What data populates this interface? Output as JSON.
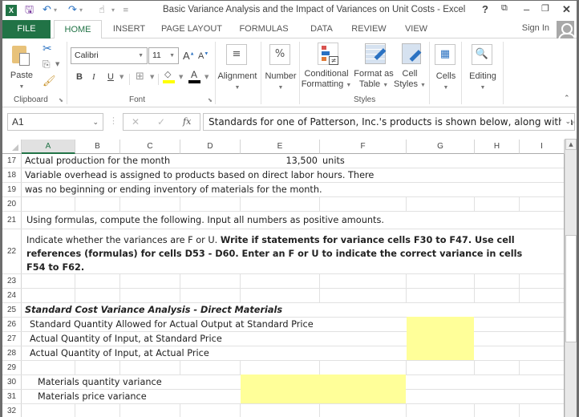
{
  "titlebar": {
    "title": "Basic Variance Analysis and the Impact of Variances on Unit Costs - Excel",
    "app_icon": "excel-icon",
    "quick_access": [
      "save-icon",
      "undo-icon",
      "redo-icon",
      "touch-mode-icon",
      "customize-qat-icon"
    ],
    "controls": {
      "help": "?",
      "ribbon_display": "⧉",
      "minimize": "–",
      "restore": "🗗",
      "close": "✕"
    }
  },
  "tabs": {
    "items": [
      "FILE",
      "HOME",
      "INSERT",
      "PAGE LAYOUT",
      "FORMULAS",
      "DATA",
      "REVIEW",
      "VIEW"
    ],
    "active": "HOME",
    "sign_in": "Sign In"
  },
  "ribbon": {
    "clipboard": {
      "label": "Clipboard",
      "paste": "Paste"
    },
    "font": {
      "label": "Font",
      "font_name": "Calibri",
      "font_size": "11",
      "bold": "B",
      "italic": "I",
      "underline": "U",
      "grow": "A",
      "shrink": "A",
      "fill_color": "#ffff00",
      "font_color": "#000000"
    },
    "alignment": {
      "label": "Alignment"
    },
    "number": {
      "label": "Number",
      "icon_text": "%"
    },
    "styles": {
      "label": "Styles",
      "conditional_formatting": [
        "Conditional",
        "Formatting"
      ],
      "format_as_table": [
        "Format as",
        "Table"
      ],
      "cell_styles": [
        "Cell",
        "Styles"
      ]
    },
    "cells": {
      "label": "Cells"
    },
    "editing": {
      "label": "Editing"
    }
  },
  "formula_bar": {
    "name_box": "A1",
    "fx": "fx",
    "cancel": "✕",
    "enter": "✓",
    "formula": "Standards for one of Patterson, Inc.'s products is shown below, along with actual"
  },
  "sheet": {
    "columns": [
      "A",
      "B",
      "C",
      "D",
      "E",
      "F",
      "G",
      "H",
      "I"
    ],
    "selected_column": "A",
    "rows": [
      {
        "num": "17",
        "cells": [
          {
            "text": "Actual production for the month"
          },
          {
            "text": "13,500",
            "align": "right"
          },
          {
            "text": "units"
          }
        ]
      },
      {
        "num": "18",
        "cells": [
          {
            "text": "Variable overhead is assigned to products based on direct labor hours. There"
          }
        ]
      },
      {
        "num": "19",
        "cells": [
          {
            "text": "was no beginning or ending inventory of materials for the month."
          }
        ]
      },
      {
        "num": "20",
        "cells": []
      },
      {
        "num": "21",
        "cells": [
          {
            "text": "Using formulas, compute the following.  Input all numbers as positive amounts."
          }
        ]
      },
      {
        "num": "22",
        "cells": [
          {
            "text_normal": "Indicate whether the variances are F or U. ",
            "text_bold_1": "Write if statements for variance cells F30 to F47. Use cell",
            "line2": "references (formulas) for cells D53 - D60. Enter an  F or U to indicate the correct variance in cells",
            "line3": "F54 to F62."
          }
        ]
      },
      {
        "num": "23",
        "cells": []
      },
      {
        "num": "24",
        "cells": []
      },
      {
        "num": "25",
        "cells": [
          {
            "text": "Standard Cost Variance Analysis - Direct Materials"
          }
        ]
      },
      {
        "num": "26",
        "cells": [
          {
            "text": "Standard Quantity Allowed for Actual Output at Standard Price"
          }
        ]
      },
      {
        "num": "27",
        "cells": [
          {
            "text": "Actual Quantity of Input, at Standard Price"
          }
        ]
      },
      {
        "num": "28",
        "cells": [
          {
            "text": "Actual Quantity of Input, at Actual Price"
          }
        ]
      },
      {
        "num": "29",
        "cells": []
      },
      {
        "num": "30",
        "cells": [
          {
            "text": "Materials quantity variance"
          }
        ]
      },
      {
        "num": "31",
        "cells": [
          {
            "text": "Materials price variance"
          }
        ]
      },
      {
        "num": "32",
        "cells": []
      }
    ],
    "highlight_color": "#ffff99"
  }
}
